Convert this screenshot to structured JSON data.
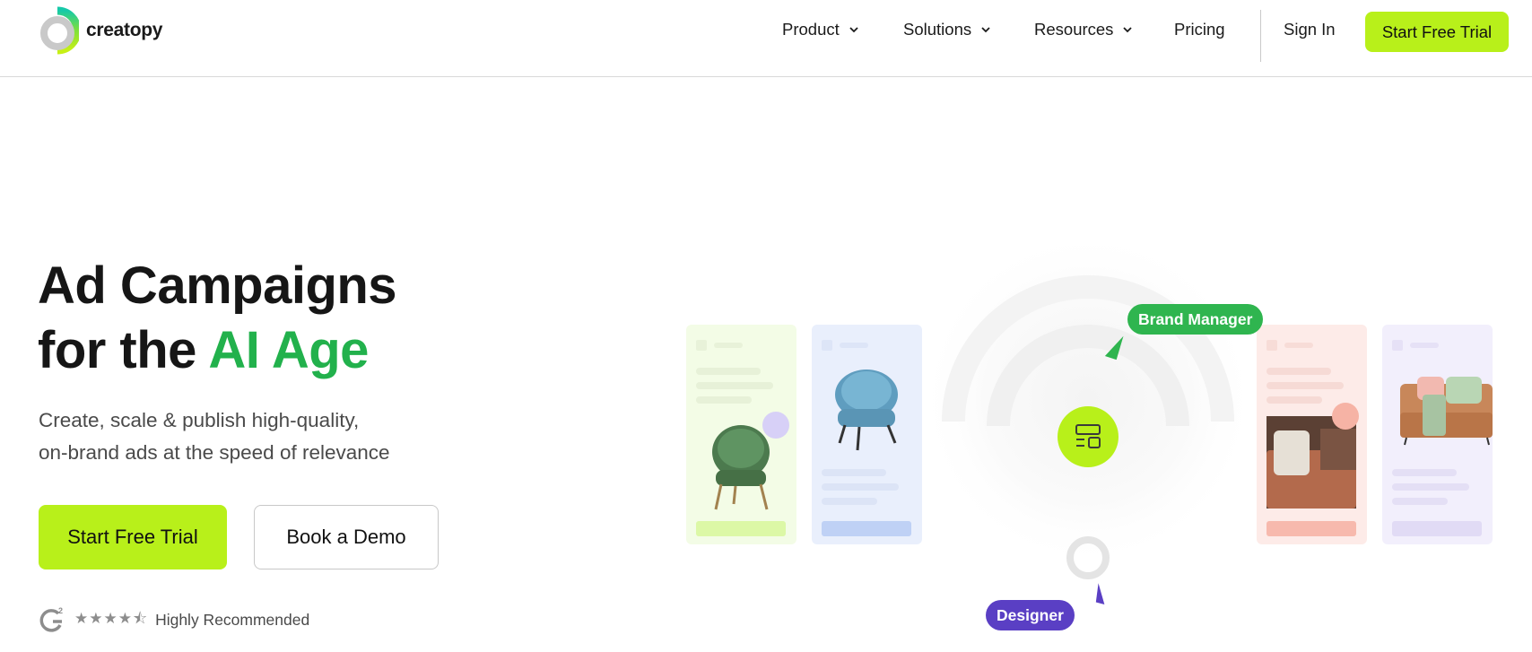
{
  "brand": {
    "name": "creatopy"
  },
  "nav": {
    "items": [
      {
        "label": "Product",
        "has_dropdown": true
      },
      {
        "label": "Solutions",
        "has_dropdown": true
      },
      {
        "label": "Resources",
        "has_dropdown": true
      },
      {
        "label": "Pricing",
        "has_dropdown": false
      }
    ],
    "sign_in": "Sign In",
    "cta": "Start Free Trial"
  },
  "hero": {
    "title_line1": "Ad Campaigns",
    "title_line2_prefix": "for the ",
    "title_line2_highlight": "AI Age",
    "subtitle_line1": "Create, scale & publish high-quality,",
    "subtitle_line2": "on-brand ads at the speed of relevance",
    "primary_cta": "Start Free Trial",
    "secondary_cta": "Book a Demo",
    "rating_stars": "★★★★⯪",
    "rating_text": "Highly Recommended"
  },
  "illustration": {
    "badge_brand_manager": "Brand Manager",
    "badge_designer": "Designer"
  },
  "colors": {
    "accent_lime": "#b8f01a",
    "title_green": "#22b14c",
    "brand_manager_badge": "#2fb54f",
    "designer_badge": "#5a3fc4"
  }
}
